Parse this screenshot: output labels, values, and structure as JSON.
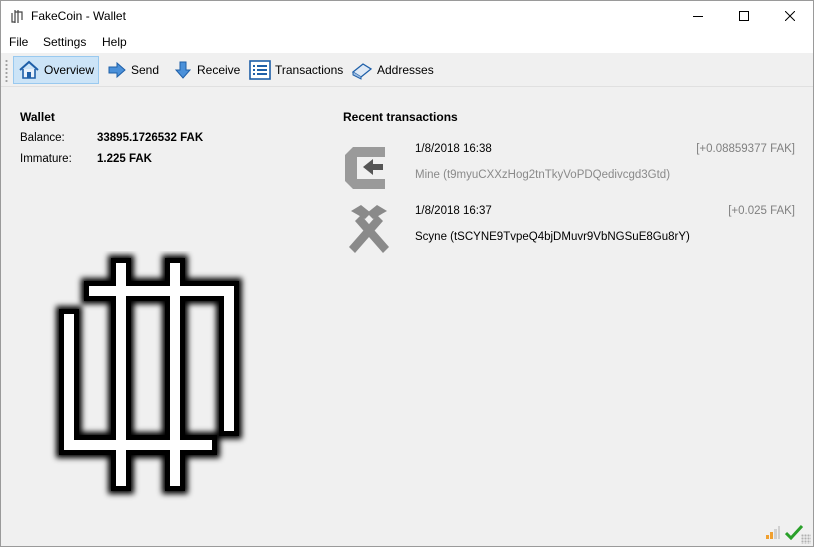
{
  "window": {
    "title": "FakeCoin - Wallet"
  },
  "menu": {
    "file": "File",
    "settings": "Settings",
    "help": "Help"
  },
  "toolbar": {
    "overview": "Overview",
    "send": "Send",
    "receive": "Receive",
    "transactions": "Transactions",
    "addresses": "Addresses"
  },
  "wallet": {
    "title": "Wallet",
    "balance_label": "Balance:",
    "balance_value": "33895.1726532 FAK",
    "immature_label": "Immature:",
    "immature_value": "1.225 FAK"
  },
  "recent": {
    "title": "Recent transactions",
    "items": [
      {
        "icon": "receive-coin-icon",
        "date": "1/8/2018 16:38",
        "amount": "[+0.08859377 FAK]",
        "address": "Mine (t9myuCXXzHog2tnTkyVoPDQedivcgd3Gtd)"
      },
      {
        "icon": "mining-icon",
        "date": "1/8/2018 16:37",
        "amount": "[+0.025 FAK]",
        "address": "Scyne (tSCYNE9TvpeQ4bjDMuvr9VbNGSuE8Gu8rY)"
      }
    ]
  },
  "colors": {
    "toolbar_active": "#cce4f7",
    "accent": "#1e6fc6",
    "muted_text": "#808080"
  }
}
